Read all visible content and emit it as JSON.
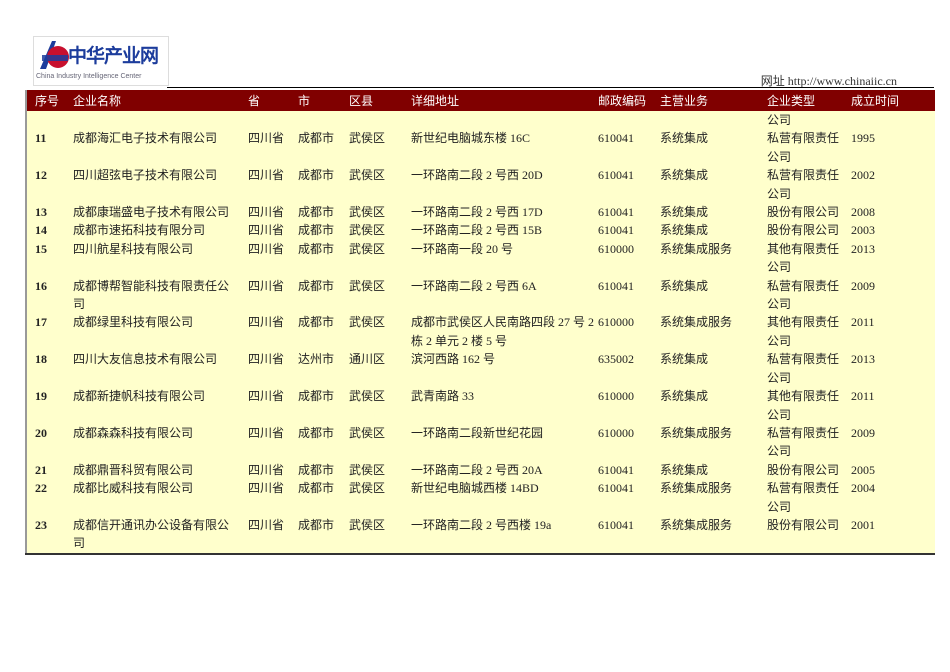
{
  "logo": {
    "name": "中华产业网",
    "tagline": "China Industry Intelligence Center"
  },
  "site": "网址 http://www.chinaiic.cn",
  "headers": [
    "序号",
    "企业名称",
    "省",
    "市",
    "区县",
    "详细地址",
    "邮政编码",
    "主营业务",
    "企业类型",
    "成立时间"
  ],
  "carryover": "公司",
  "rows": [
    [
      "11",
      "成都海汇电子技术有限公司",
      "四川省",
      "成都市",
      "武侯区",
      "新世纪电脑城东楼 16C",
      "610041",
      "系统集成",
      "私营有限责任公司",
      "1995"
    ],
    [
      "12",
      "四川超弦电子技术有限公司",
      "四川省",
      "成都市",
      "武侯区",
      "一环路南二段 2 号西 20D",
      "610041",
      "系统集成",
      "私营有限责任公司",
      "2002"
    ],
    [
      "13",
      "成都康瑞盛电子技术有限公司",
      "四川省",
      "成都市",
      "武侯区",
      "一环路南二段 2 号西 17D",
      "610041",
      "系统集成",
      "股份有限公司",
      "2008"
    ],
    [
      "14",
      "成都市速拓科技有限分司",
      "四川省",
      "成都市",
      "武侯区",
      "一环路南二段 2 号西 15B",
      "610041",
      "系统集成",
      "股份有限公司",
      "2003"
    ],
    [
      "15",
      "四川航星科技有限公司",
      "四川省",
      "成都市",
      "武侯区",
      "一环路南一段 20 号",
      "610000",
      "系统集成服务",
      "其他有限责任公司",
      "2013"
    ],
    [
      "16",
      "成都博帮智能科技有限责任公司",
      "四川省",
      "成都市",
      "武侯区",
      "一环路南二段 2 号西 6A",
      "610041",
      "系统集成",
      "私营有限责任公司",
      "2009"
    ],
    [
      "17",
      "成都绿里科技有限公司",
      "四川省",
      "成都市",
      "武侯区",
      "成都市武侯区人民南路四段 27 号 2 栋 2 单元 2 楼 5 号",
      "610000",
      "系统集成服务",
      "其他有限责任公司",
      "2011"
    ],
    [
      "18",
      "四川大友信息技术有限公司",
      "四川省",
      "达州市",
      "通川区",
      "滨河西路 162 号",
      "635002",
      "系统集成",
      "私营有限责任公司",
      "2013"
    ],
    [
      "19",
      "成都新捷帆科技有限公司",
      "四川省",
      "成都市",
      "武侯区",
      "武青南路 33",
      "610000",
      "系统集成",
      "其他有限责任公司",
      "2011"
    ],
    [
      "20",
      "成都森森科技有限公司",
      "四川省",
      "成都市",
      "武侯区",
      "一环路南二段新世纪花园",
      "610000",
      "系统集成服务",
      "私营有限责任公司",
      "2009"
    ],
    [
      "21",
      "成都鼎晋科贸有限公司",
      "四川省",
      "成都市",
      "武侯区",
      "一环路南二段 2 号西 20A",
      "610041",
      "系统集成",
      "股份有限公司",
      "2005"
    ],
    [
      "22",
      "成都比威科技有限公司",
      "四川省",
      "成都市",
      "武侯区",
      "新世纪电脑城西楼 14BD",
      "610041",
      "系统集成服务",
      "私营有限责任公司",
      "2004"
    ],
    [
      "23",
      "成都信开通讯办公设备有限公司",
      "四川省",
      "成都市",
      "武侯区",
      "一环路南二段 2 号西楼 19a",
      "610041",
      "系统集成服务",
      "股份有限公司",
      "2001"
    ]
  ]
}
